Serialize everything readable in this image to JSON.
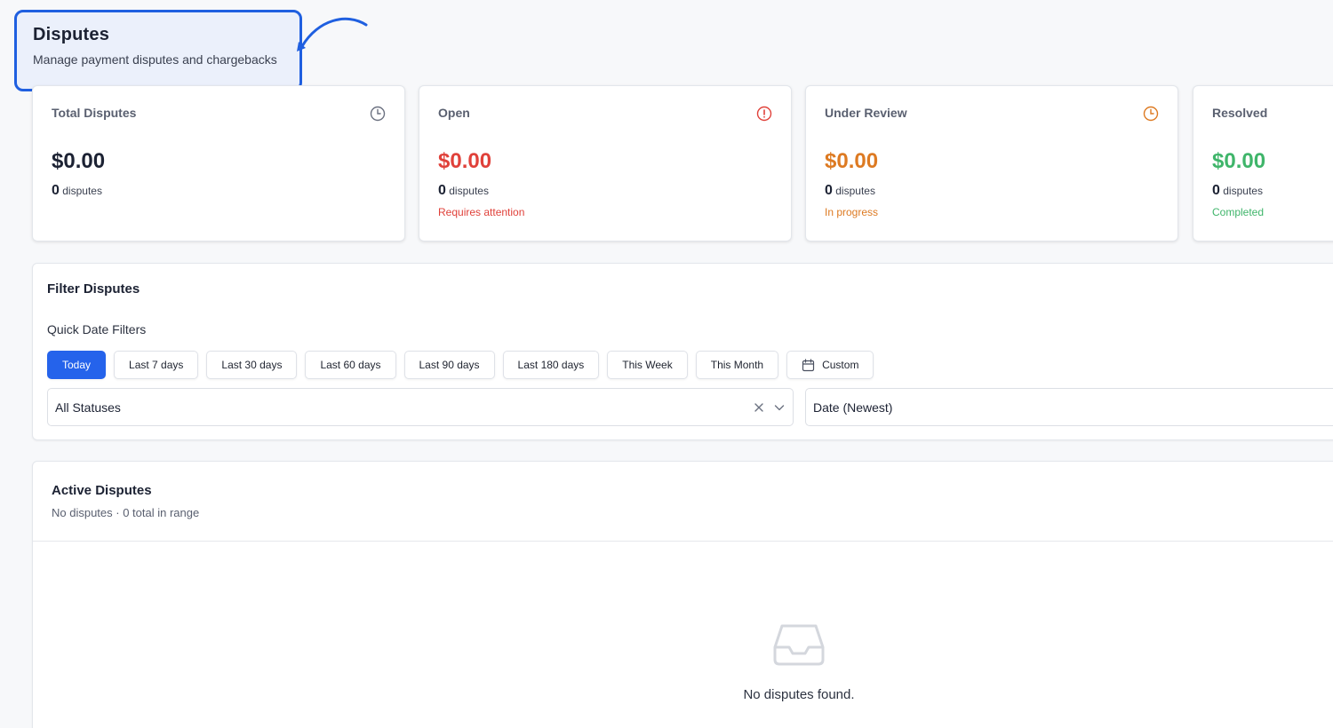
{
  "header": {
    "title": "Disputes",
    "subtitle": "Manage payment disputes and chargebacks"
  },
  "stats": [
    {
      "label": "Total Disputes",
      "amount": "$0.00",
      "count": "0",
      "count_unit": "disputes",
      "note": "",
      "icon": "clock-icon",
      "color": "#1c2233"
    },
    {
      "label": "Open",
      "amount": "$0.00",
      "count": "0",
      "count_unit": "disputes",
      "note": "Requires attention",
      "icon": "alert-circle-icon",
      "color": "#e0413a"
    },
    {
      "label": "Under Review",
      "amount": "$0.00",
      "count": "0",
      "count_unit": "disputes",
      "note": "In progress",
      "icon": "clock-icon",
      "color": "#dd7a22"
    },
    {
      "label": "Resolved",
      "amount": "$0.00",
      "count": "0",
      "count_unit": "disputes",
      "note": "Completed",
      "icon": "check-circle-icon",
      "color": "#3fb56a"
    }
  ],
  "filters": {
    "title": "Filter Disputes",
    "quick_label": "Quick Date Filters",
    "chips": [
      "Today",
      "Last 7 days",
      "Last 30 days",
      "Last 60 days",
      "Last 90 days",
      "Last 180 days",
      "This Week",
      "This Month",
      "Custom"
    ],
    "active_chip": "Today",
    "status_select": "All Statuses",
    "sort_select": "Date (Newest)"
  },
  "active": {
    "title": "Active Disputes",
    "subtitle": "No disputes · 0 total in range",
    "empty_text": "No disputes found.",
    "empty_icon": "inbox-icon"
  },
  "colors": {
    "accent": "#2563eb",
    "highlight_border": "#1f5fe0"
  }
}
